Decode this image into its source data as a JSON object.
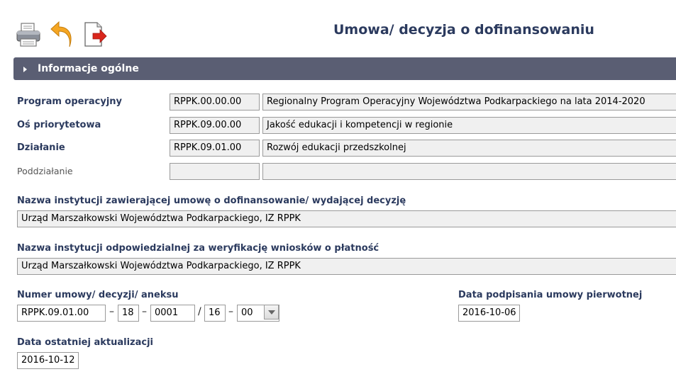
{
  "title": "Umowa/ decyzja o dofinansowaniu",
  "section": {
    "label": "Informacje ogólne"
  },
  "program": {
    "label": "Program operacyjny",
    "code": "RPPK.00.00.00",
    "name": "Regionalny Program Operacyjny Województwa Podkarpackiego na lata 2014-2020"
  },
  "os": {
    "label": "Oś priorytetowa",
    "code": "RPPK.09.00.00",
    "name": "Jakość edukacji i kompetencji w regionie"
  },
  "dzialanie": {
    "label": "Działanie",
    "code": "RPPK.09.01.00",
    "name": "Rozwój edukacji przedszkolnej"
  },
  "poddzialanie": {
    "label": "Poddziałanie",
    "code": "",
    "name": ""
  },
  "instytucja_zawierajaca": {
    "label": "Nazwa instytucji zawierającej umowę o dofinansowanie/ wydającej decyzję",
    "value": "Urząd Marszałkowski Województwa Podkarpackiego, IZ RPPK"
  },
  "instytucja_odpowiedzialna": {
    "label": "Nazwa instytucji odpowiedzialnej za weryfikację wniosków o płatność",
    "value": "Urząd Marszałkowski Województwa Podkarpackiego, IZ RPPK"
  },
  "numer": {
    "label": "Numer umowy/ decyzji/ aneksu",
    "part1": "RPPK.09.01.00",
    "part2": "18",
    "part3": "0001",
    "part4": "16",
    "part5": "00",
    "sep_dash": "–",
    "sep_slash": "/"
  },
  "data_podpisania": {
    "label": "Data podpisania umowy pierwotnej",
    "value": "2016-10-06"
  },
  "data_aktualizacji": {
    "label": "Data ostatniej aktualizacji",
    "value": "2016-10-12"
  },
  "colors": {
    "header_bar": "#5a5e73",
    "label_text": "#2b3a5e",
    "field_bg": "#f0f0f0"
  },
  "icons": [
    "printer-icon",
    "back-arrow-icon",
    "export-icon"
  ]
}
